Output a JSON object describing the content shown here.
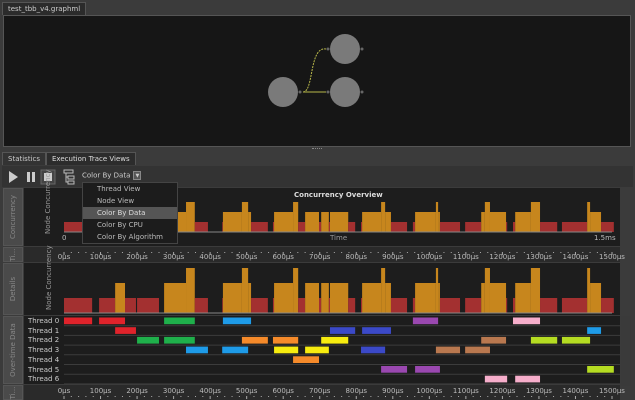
{
  "file_tab": "test_tbb_v4.graphml",
  "graph": {
    "nodes": [
      {
        "id": "n0"
      },
      {
        "id": "n1"
      },
      {
        "id": "n2"
      }
    ]
  },
  "tabs": [
    "Statistics",
    "Execution Trace Views"
  ],
  "toolbar": {
    "color_mode": "Color By Data",
    "icons": [
      "play-icon",
      "pause-icon",
      "stop-icon",
      "hierarchy-icon"
    ]
  },
  "menu": {
    "items": [
      "Thread View",
      "Node View",
      "Color By Data",
      "Color By CPU",
      "Color By Algorithm"
    ],
    "selected": 2
  },
  "side_labels": {
    "overview": "Concurrency",
    "time1": "Ti...",
    "details": "Details",
    "overtime": "Over-time Data",
    "time2": "Ti..."
  },
  "overview": {
    "title": "Concurrency Overview",
    "ylabel": "Node Concurrency",
    "x_start": "0",
    "x_label": "Time",
    "x_end": "1.5ms"
  },
  "details": {
    "ylabel": "Node Concurrency"
  },
  "axis_ticks": [
    "0μs",
    "100μs",
    "200μs",
    "300μs",
    "400μs",
    "500μs",
    "600μs",
    "700μs",
    "800μs",
    "900μs",
    "1000μs",
    "1100μs",
    "1200μs",
    "1300μs",
    "1400μs",
    "1500μs"
  ],
  "colors": {
    "red": "#e0232b",
    "blue_sky": "#1e9be8",
    "green": "#1fb04b",
    "orange": "#f58a2a",
    "yellow": "#f7ec0f",
    "royal": "#3b49c8",
    "purple": "#9a48b0",
    "pink": "#f6aecb",
    "brown": "#b9784f",
    "lime": "#b5dc22",
    "conc1": "#a33030",
    "conc2": "#c7861d"
  },
  "chart_data": {
    "type": "gantt",
    "x_unit": "μs",
    "xlim": [
      0,
      1500
    ],
    "threads": [
      {
        "name": "Thread 0",
        "tasks": [
          [
            0,
            77,
            "red"
          ],
          [
            96,
            167,
            "red"
          ],
          [
            274,
            358,
            "green"
          ],
          [
            435,
            512,
            "blue_sky"
          ],
          [
            955,
            1024,
            "purple"
          ],
          [
            1229,
            1303,
            "pink"
          ]
        ]
      },
      {
        "name": "Thread 1",
        "tasks": [
          [
            140,
            197,
            "red"
          ],
          [
            728,
            797,
            "royal"
          ],
          [
            816,
            895,
            "royal"
          ],
          [
            1432,
            1470,
            "blue_sky"
          ]
        ]
      },
      {
        "name": "Thread 2",
        "tasks": [
          [
            200,
            260,
            "green"
          ],
          [
            274,
            358,
            "green"
          ],
          [
            487,
            558,
            "orange"
          ],
          [
            572,
            641,
            "orange"
          ],
          [
            704,
            778,
            "yellow"
          ],
          [
            1142,
            1210,
            "brown"
          ],
          [
            1278,
            1350,
            "lime"
          ],
          [
            1363,
            1440,
            "lime"
          ]
        ]
      },
      {
        "name": "Thread 3",
        "tasks": [
          [
            334,
            394,
            "blue_sky"
          ],
          [
            433,
            504,
            "blue_sky"
          ],
          [
            575,
            641,
            "yellow"
          ],
          [
            660,
            725,
            "yellow"
          ],
          [
            813,
            879,
            "royal"
          ],
          [
            1018,
            1084,
            "brown"
          ],
          [
            1098,
            1166,
            "brown"
          ]
        ]
      },
      {
        "name": "Thread 4",
        "tasks": [
          [
            627,
            698,
            "orange"
          ]
        ]
      },
      {
        "name": "Thread 5",
        "tasks": [
          [
            868,
            939,
            "purple"
          ],
          [
            961,
            1029,
            "purple"
          ],
          [
            1432,
            1505,
            "lime"
          ]
        ]
      },
      {
        "name": "Thread 6",
        "tasks": [
          [
            1152,
            1213,
            "pink"
          ],
          [
            1235,
            1303,
            "pink"
          ]
        ]
      }
    ]
  }
}
